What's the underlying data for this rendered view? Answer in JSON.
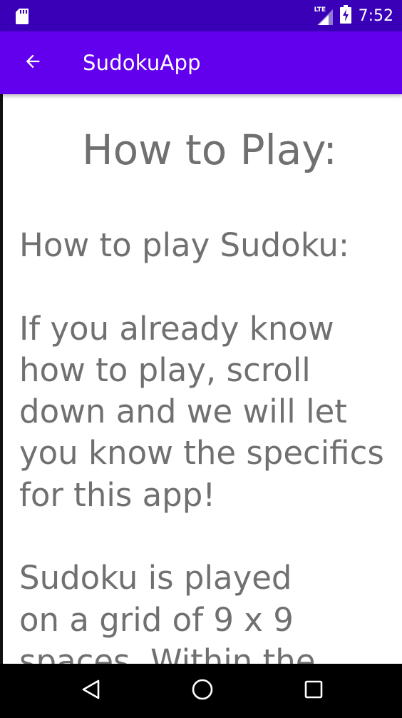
{
  "status_bar": {
    "time": "7:52",
    "network_label": "LTE",
    "icons": [
      "sd-card-icon",
      "signal-icon",
      "battery-charging-icon"
    ]
  },
  "app_bar": {
    "title": "SudokuApp",
    "back_icon": "arrow-back-icon"
  },
  "content": {
    "heading": "How to Play:",
    "lines": [
      "How to play Sudoku:",
      "",
      "If you already know",
      "how to play, scroll",
      "down and we will let",
      "you know the specifics",
      "for this app!",
      "",
      "Sudoku is played",
      "on a grid of 9 x 9",
      "spaces. Within the"
    ]
  },
  "nav_bar": {
    "icons": [
      "nav-back-icon",
      "nav-home-icon",
      "nav-recents-icon"
    ]
  },
  "colors": {
    "status_bar": "#3a00b8",
    "app_bar": "#6200ee",
    "text": "#707070",
    "nav_bar": "#000000"
  }
}
